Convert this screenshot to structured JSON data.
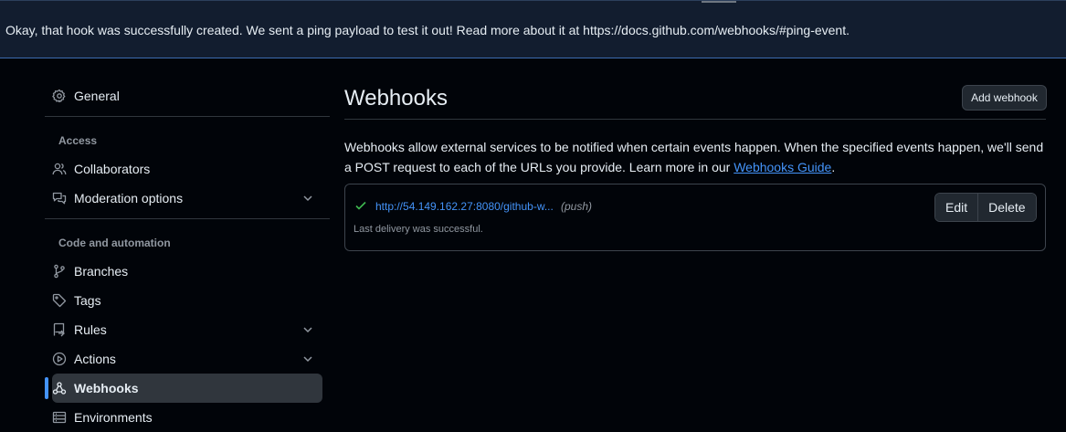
{
  "flash": {
    "message": "Okay, that hook was successfully created. We sent a ping payload to test it out! Read more about it at https://docs.github.com/webhooks/#ping-event."
  },
  "sidebar": {
    "general": "General",
    "sections": [
      {
        "heading": "Access",
        "items": [
          {
            "label": "Collaborators",
            "icon": "people-icon"
          },
          {
            "label": "Moderation options",
            "icon": "comment-discussion-icon",
            "expandable": true
          }
        ]
      },
      {
        "heading": "Code and automation",
        "items": [
          {
            "label": "Branches",
            "icon": "git-branch-icon"
          },
          {
            "label": "Tags",
            "icon": "tag-icon"
          },
          {
            "label": "Rules",
            "icon": "repo-push-icon",
            "expandable": true
          },
          {
            "label": "Actions",
            "icon": "play-icon",
            "expandable": true
          },
          {
            "label": "Webhooks",
            "icon": "webhook-icon",
            "active": true
          },
          {
            "label": "Environments",
            "icon": "server-icon"
          }
        ]
      }
    ]
  },
  "main": {
    "title": "Webhooks",
    "add_button": "Add webhook",
    "description_prefix": "Webhooks allow external services to be notified when certain events happen. When the specified events happen, we'll send a POST request to each of the URLs you provide. Learn more in our ",
    "description_link": "Webhooks Guide",
    "description_suffix": ".",
    "hook": {
      "url": "http://54.149.162.27:8080/github-w...",
      "event": "(push)",
      "status": "Last delivery was successful.",
      "edit_label": "Edit",
      "delete_label": "Delete"
    }
  },
  "colors": {
    "accent": "#4493f8",
    "success": "#3fb950",
    "background": "#010409",
    "flash_background": "#121d2f"
  }
}
